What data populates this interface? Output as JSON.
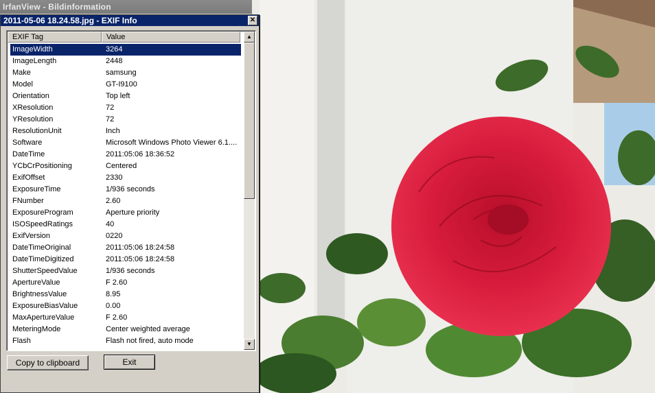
{
  "main_window": {
    "title": "IrfanView - Bildinformation"
  },
  "dialog": {
    "title": "2011-05-06 18.24.58.jpg - EXIF Info",
    "close_glyph": "✕"
  },
  "columns": {
    "tag": "EXIF Tag",
    "value": "Value"
  },
  "rows": [
    {
      "tag": "ImageWidth",
      "value": "3264",
      "selected": true
    },
    {
      "tag": "ImageLength",
      "value": "2448"
    },
    {
      "tag": "Make",
      "value": "samsung"
    },
    {
      "tag": "Model",
      "value": "GT-I9100"
    },
    {
      "tag": "Orientation",
      "value": "Top left"
    },
    {
      "tag": "XResolution",
      "value": "72"
    },
    {
      "tag": "YResolution",
      "value": "72"
    },
    {
      "tag": "ResolutionUnit",
      "value": "Inch"
    },
    {
      "tag": "Software",
      "value": "Microsoft Windows Photo Viewer 6.1...."
    },
    {
      "tag": "DateTime",
      "value": "2011:05:06 18:36:52"
    },
    {
      "tag": "YCbCrPositioning",
      "value": "Centered"
    },
    {
      "tag": "ExifOffset",
      "value": "2330"
    },
    {
      "tag": "ExposureTime",
      "value": "1/936 seconds"
    },
    {
      "tag": "FNumber",
      "value": "2.60"
    },
    {
      "tag": "ExposureProgram",
      "value": "Aperture priority"
    },
    {
      "tag": "ISOSpeedRatings",
      "value": "40"
    },
    {
      "tag": "ExifVersion",
      "value": "0220"
    },
    {
      "tag": "DateTimeOriginal",
      "value": "2011:05:06 18:24:58"
    },
    {
      "tag": "DateTimeDigitized",
      "value": "2011:05:06 18:24:58"
    },
    {
      "tag": "ShutterSpeedValue",
      "value": "1/936 seconds"
    },
    {
      "tag": "ApertureValue",
      "value": "F 2.60"
    },
    {
      "tag": "BrightnessValue",
      "value": "8.95"
    },
    {
      "tag": "ExposureBiasValue",
      "value": "0.00"
    },
    {
      "tag": "MaxApertureValue",
      "value": "F 2.60"
    },
    {
      "tag": "MeteringMode",
      "value": "Center weighted average"
    },
    {
      "tag": "Flash",
      "value": "Flash not fired, auto mode"
    }
  ],
  "scrollbar": {
    "up_glyph": "▲",
    "down_glyph": "▼"
  },
  "buttons": {
    "copy": "Copy to clipboard",
    "exit": "Exit"
  },
  "icons": {
    "close": "close-icon",
    "scroll_up": "scroll-up-icon",
    "scroll_down": "scroll-down-icon"
  },
  "colors": {
    "titlebar": "#0a246a",
    "selection": "#0a246a",
    "rose": "#d0183a",
    "leaf": "#3d6b2a",
    "wall": "#e9e7e2"
  }
}
